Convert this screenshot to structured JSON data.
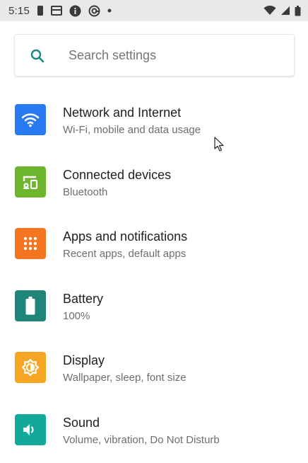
{
  "status_bar": {
    "time": "5:15",
    "icons_left": [
      "phone-icon",
      "sim-card-icon",
      "info-icon",
      "vpn-icon",
      "dot-icon"
    ],
    "icons_right": [
      "wifi-icon",
      "signal-icon",
      "battery-icon"
    ]
  },
  "search": {
    "placeholder": "Search settings",
    "icon": "search-icon"
  },
  "settings": [
    {
      "title": "Network and Internet",
      "summary": "Wi‑Fi, mobile and data usage",
      "icon": "wifi-icon",
      "color": "#2979f2"
    },
    {
      "title": "Connected devices",
      "summary": "Bluetooth",
      "icon": "devices-icon",
      "color": "#6cb52d"
    },
    {
      "title": "Apps and notifications",
      "summary": "Recent apps, default apps",
      "icon": "apps-grid-icon",
      "color": "#f5741f"
    },
    {
      "title": "Battery",
      "summary": "100%",
      "icon": "battery-icon",
      "color": "#1f857a"
    },
    {
      "title": "Display",
      "summary": "Wallpaper, sleep, font size",
      "icon": "brightness-icon",
      "color": "#f6a623"
    },
    {
      "title": "Sound",
      "summary": "Volume, vibration, Do Not Disturb",
      "icon": "volume-icon",
      "color": "#12a89a"
    }
  ],
  "colors": {
    "accent": "#1a8a80",
    "status_bar_bg": "#e9e9e9"
  }
}
